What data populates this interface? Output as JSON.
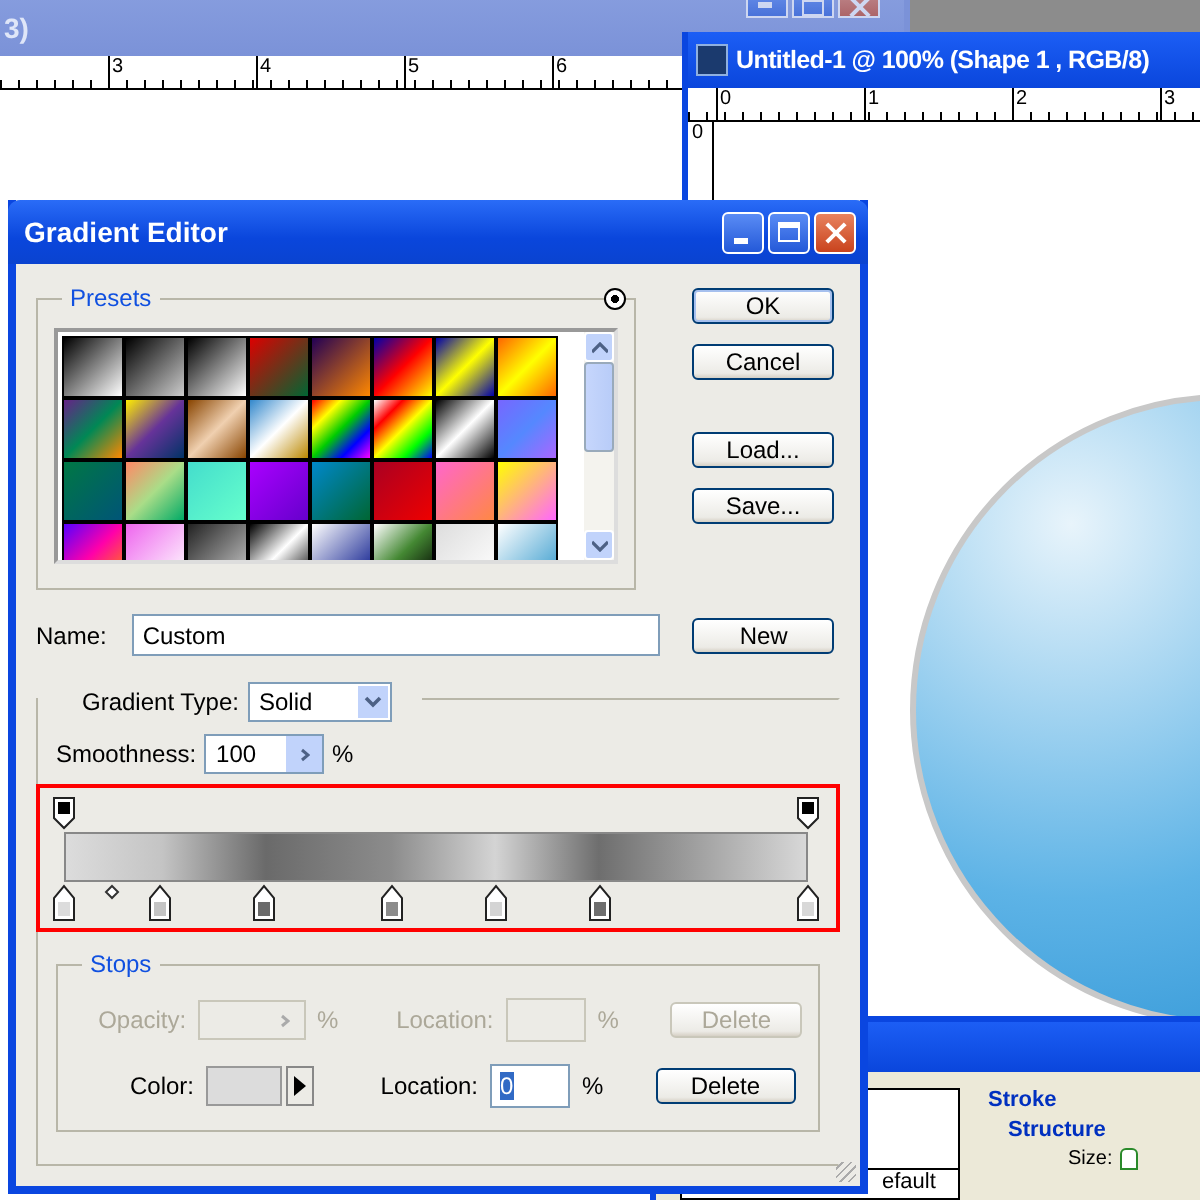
{
  "background_window": {
    "title": "3)",
    "ruler_marks": [
      "3",
      "4",
      "5",
      "6"
    ]
  },
  "document_window": {
    "title": "Untitled-1 @ 100% (Shape 1 , RGB/8)",
    "ruler_marks": [
      "0",
      "1",
      "2",
      "3"
    ],
    "vertical_ruler_marks": [
      "0"
    ]
  },
  "layer_style_dialog": {
    "list_item": "efault",
    "section": "Stroke",
    "subsection": "Structure",
    "size_label": "Size:"
  },
  "gradient_editor": {
    "title": "Gradient Editor",
    "presets": {
      "label": "Presets"
    },
    "buttons": [
      "OK",
      "Cancel",
      "Load...",
      "Save..."
    ],
    "name": {
      "label": "Name:",
      "value": "Custom"
    },
    "new_button": "New",
    "gradient_type": {
      "label": "Gradient Type:",
      "value": "Solid"
    },
    "smoothness": {
      "label": "Smoothness:",
      "value": "100",
      "unit": "%"
    },
    "gradient_bar": {
      "opacity_stops": [
        {
          "level": 0
        },
        {
          "level": 1
        }
      ],
      "color_stops": [
        {
          "level": 0,
          "color": "#dcdcdc"
        },
        {
          "level": 0.13,
          "color": "#c4c4c4"
        },
        {
          "level": 0.27,
          "color": "#6a6a6a"
        },
        {
          "level": 0.44,
          "color": "#8c8c8c"
        },
        {
          "level": 0.58,
          "color": "#d4d4d4"
        },
        {
          "level": 0.72,
          "color": "#6e6e6e"
        },
        {
          "level": 1,
          "color": "#d8d8d8"
        }
      ]
    },
    "stops": {
      "label": "Stops",
      "opacity_row": {
        "label": "Opacity:",
        "unit": "%",
        "location_label": "Location:",
        "location_unit": "%",
        "delete": "Delete",
        "disabled": true
      },
      "color_row": {
        "label": "Color:",
        "location_label": "Location:",
        "location_value": "0",
        "location_unit": "%",
        "delete": "Delete",
        "disabled": false
      }
    }
  }
}
